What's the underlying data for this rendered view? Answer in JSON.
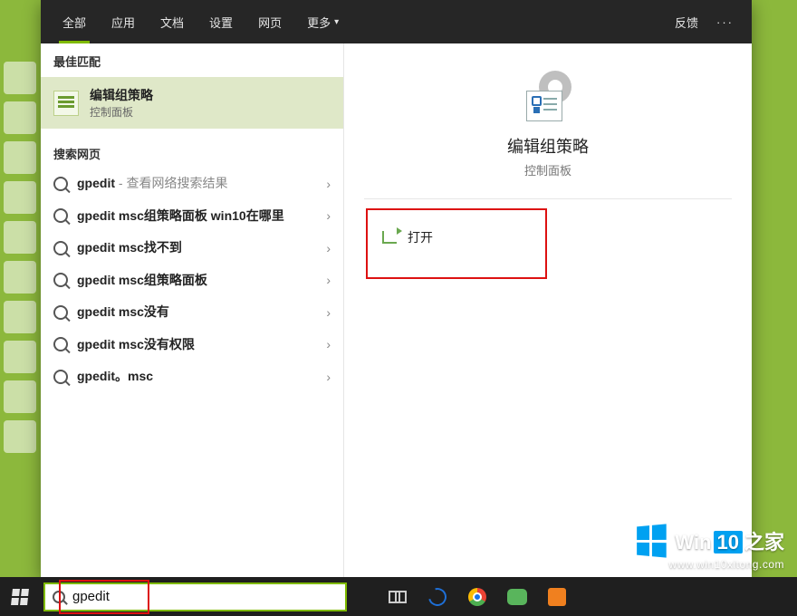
{
  "topbar": {
    "tabs": [
      "全部",
      "应用",
      "文档",
      "设置",
      "网页",
      "更多"
    ],
    "active_index": 0,
    "feedback": "反馈"
  },
  "sections": {
    "best_match_header": "最佳匹配",
    "web_header": "搜索网页"
  },
  "best_match": {
    "title": "编辑组策略",
    "subtitle": "控制面板"
  },
  "web_results": [
    {
      "bold": "gpedit",
      "rest": "",
      "hint": " - 查看网络搜索结果"
    },
    {
      "bold": "gpedit msc组策略面板 win10在哪里",
      "rest": "",
      "hint": ""
    },
    {
      "bold": "gpedit msc找不到",
      "rest": "",
      "hint": ""
    },
    {
      "bold": "gpedit msc组策略面板",
      "rest": "",
      "hint": ""
    },
    {
      "bold": "gpedit msc没有",
      "rest": "",
      "hint": ""
    },
    {
      "bold": "gpedit msc没有权限",
      "rest": "",
      "hint": ""
    },
    {
      "bold": "gpedit。msc",
      "rest": "",
      "hint": ""
    }
  ],
  "preview": {
    "title": "编辑组策略",
    "subtitle": "控制面板",
    "open_label": "打开"
  },
  "search": {
    "value": "gpedit",
    "placeholder": ""
  },
  "watermark": {
    "brand_prefix": "Win",
    "brand_accent": "10",
    "brand_suffix": "之家",
    "url": "www.win10xitong.com"
  }
}
